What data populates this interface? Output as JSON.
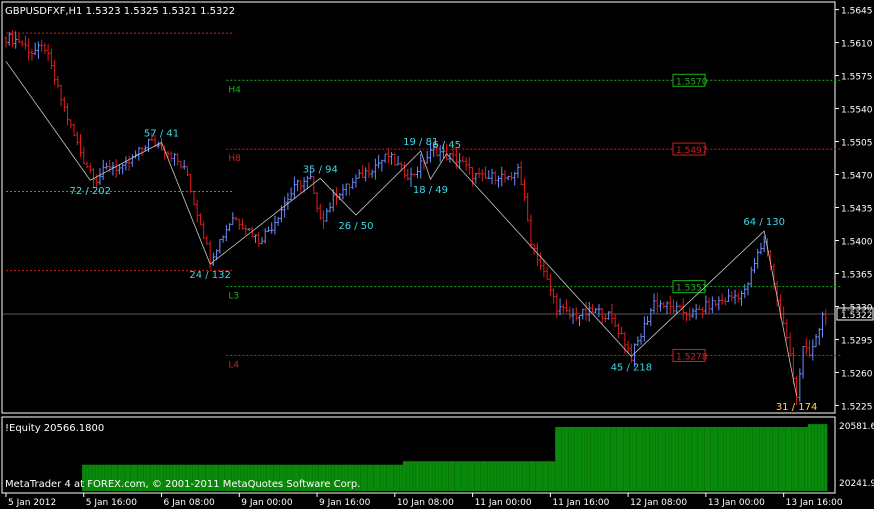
{
  "header": {
    "title": "GBPUSDFXF,H1  1.5323 1.5325 1.5321 1.5322"
  },
  "footer": {
    "copyright": "MetaTrader 4 at FOREX.com, © 2001-2011 MetaQuotes Software Corp."
  },
  "colors": {
    "background": "#000000",
    "border": "#ffffff",
    "bull_bar": "#6b8dff",
    "bear_bar": "#e21b1b",
    "zigzag": "#c8c8c8",
    "zigzag_label": "#3fd7e8",
    "zigzag_label_low_end": "#ffd84a",
    "level_green": "#1db31d",
    "level_red": "#d11f1f",
    "equity_bar": "#0a8a0a",
    "text": "#ffffff"
  },
  "chart_data": [
    {
      "type": "ohlc",
      "symbol": "GBPUSDFXF",
      "timeframe": "H1",
      "last_quote": {
        "open": 1.5323,
        "high": 1.5325,
        "low": 1.5321,
        "close": 1.5322
      },
      "ylim": [
        1.5218,
        1.5652
      ],
      "y_ticks": [
        "1.5645",
        "1.5610",
        "1.5575",
        "1.5540",
        "1.5505",
        "1.5470",
        "1.5435",
        "1.5400",
        "1.5365",
        "1.5330",
        "1.5295",
        "1.5260",
        "1.5225"
      ],
      "current_price_label": "1.5322",
      "x_ticks": [
        "5 Jan 2012",
        "5 Jan 16:00",
        "6 Jan 08:00",
        "9 Jan 00:00",
        "9 Jan 16:00",
        "10 Jan 08:00",
        "11 Jan 00:00",
        "11 Jan 16:00",
        "12 Jan 08:00",
        "13 Jan 00:00",
        "13 Jan 16:00"
      ],
      "price_path": [
        [
          0,
          1.5615
        ],
        [
          4,
          1.5612
        ],
        [
          8,
          1.56
        ],
        [
          12,
          1.5605
        ],
        [
          16,
          1.556
        ],
        [
          20,
          1.552
        ],
        [
          24,
          1.5485
        ],
        [
          28,
          1.5465
        ],
        [
          32,
          1.548
        ],
        [
          36,
          1.5475
        ],
        [
          40,
          1.549
        ],
        [
          44,
          1.5505
        ],
        [
          48,
          1.55
        ],
        [
          52,
          1.5488
        ],
        [
          56,
          1.547
        ],
        [
          58,
          1.544
        ],
        [
          60,
          1.542
        ],
        [
          63,
          1.538
        ],
        [
          66,
          1.54
        ],
        [
          70,
          1.5425
        ],
        [
          74,
          1.5415
        ],
        [
          78,
          1.54
        ],
        [
          82,
          1.5415
        ],
        [
          86,
          1.544
        ],
        [
          90,
          1.546
        ],
        [
          94,
          1.5465
        ],
        [
          96,
          1.543
        ],
        [
          98,
          1.5425
        ],
        [
          102,
          1.545
        ],
        [
          106,
          1.5458
        ],
        [
          110,
          1.547
        ],
        [
          114,
          1.548
        ],
        [
          118,
          1.549
        ],
        [
          122,
          1.5475
        ],
        [
          125,
          1.5468
        ],
        [
          128,
          1.548
        ],
        [
          132,
          1.5497
        ],
        [
          136,
          1.549
        ],
        [
          140,
          1.5485
        ],
        [
          144,
          1.547
        ],
        [
          148,
          1.5465
        ],
        [
          152,
          1.547
        ],
        [
          156,
          1.5462
        ],
        [
          158,
          1.548
        ],
        [
          160,
          1.5442
        ],
        [
          162,
          1.54
        ],
        [
          166,
          1.5365
        ],
        [
          170,
          1.533
        ],
        [
          174,
          1.532
        ],
        [
          178,
          1.5322
        ],
        [
          182,
          1.5325
        ],
        [
          186,
          1.532
        ],
        [
          190,
          1.53
        ],
        [
          193,
          1.5277
        ],
        [
          196,
          1.53
        ],
        [
          200,
          1.5335
        ],
        [
          204,
          1.533
        ],
        [
          208,
          1.5325
        ],
        [
          212,
          1.5322
        ],
        [
          216,
          1.533
        ],
        [
          220,
          1.5335
        ],
        [
          224,
          1.534
        ],
        [
          228,
          1.5345
        ],
        [
          232,
          1.5385
        ],
        [
          234,
          1.54
        ],
        [
          236,
          1.5375
        ],
        [
          238,
          1.5335
        ],
        [
          240,
          1.531
        ],
        [
          242,
          1.528
        ],
        [
          244,
          1.5235
        ],
        [
          246,
          1.5285
        ],
        [
          248,
          1.5278
        ],
        [
          250,
          1.5295
        ],
        [
          252,
          1.532
        ],
        [
          253,
          1.5322
        ]
      ],
      "zigzag": {
        "points": [
          [
            0,
            1.559
          ],
          [
            26,
            1.5464
          ],
          [
            48,
            1.5504
          ],
          [
            63,
            1.5375
          ],
          [
            97,
            1.5466
          ],
          [
            108,
            1.5427
          ],
          [
            128,
            1.5495
          ],
          [
            131,
            1.5465
          ],
          [
            136,
            1.5492
          ],
          [
            193,
            1.5277
          ],
          [
            234,
            1.541
          ],
          [
            244,
            1.5235
          ]
        ],
        "labels": [
          {
            "text": "72 / 202",
            "i": 26,
            "price": 1.5464,
            "pos": "below"
          },
          {
            "text": "57 / 41",
            "i": 48,
            "price": 1.5504,
            "pos": "above"
          },
          {
            "text": "24 / 132",
            "i": 63,
            "price": 1.5375,
            "pos": "below"
          },
          {
            "text": "35 / 94",
            "i": 97,
            "price": 1.5466,
            "pos": "above"
          },
          {
            "text": "26 / 50",
            "i": 108,
            "price": 1.5427,
            "pos": "below"
          },
          {
            "text": "19 / 81",
            "i": 128,
            "price": 1.5495,
            "pos": "above"
          },
          {
            "text": "18 / 49",
            "i": 131,
            "price": 1.5465,
            "pos": "below"
          },
          {
            "text": "6 / 45",
            "i": 136,
            "price": 1.5492,
            "pos": "above"
          },
          {
            "text": "45 / 218",
            "i": 193,
            "price": 1.5277,
            "pos": "below"
          },
          {
            "text": "64 / 130",
            "i": 234,
            "price": 1.541,
            "pos": "above"
          },
          {
            "text": "31 / 174",
            "i": 244,
            "price": 1.5235,
            "pos": "below",
            "color": "zigzag_label_low_end"
          }
        ]
      },
      "levels": [
        {
          "label": "",
          "price": 1.562,
          "color": "level_red",
          "from": 0,
          "to": 68
        },
        {
          "label": "H4",
          "price": 1.557,
          "color": "level_green",
          "from": 68,
          "to": 256,
          "tag": "1.5570"
        },
        {
          "label": "H8",
          "price": 1.5497,
          "color": "level_red",
          "from": 68,
          "to": 256,
          "tag": "1.5497"
        },
        {
          "label": "",
          "price": 1.5452,
          "color": "level_green",
          "from": 0,
          "to": 68
        },
        {
          "label": "",
          "price": 1.5368,
          "color": "level_red",
          "from": 0,
          "to": 68
        },
        {
          "label": "L3",
          "price": 1.5351,
          "color": "level_green",
          "from": 68,
          "to": 256,
          "tag": "1.5351"
        },
        {
          "label": "L4",
          "price": 1.5278,
          "color": "level_red",
          "from": 68,
          "to": 256,
          "tag": "1.5278"
        }
      ]
    },
    {
      "type": "bar",
      "name": "!Equity 20566.1800",
      "ylim": [
        20241.9,
        20581.6
      ],
      "y_ticks": [
        "20581.6",
        "20241.9"
      ],
      "segments": [
        {
          "from": 0,
          "to": 24,
          "value": null
        },
        {
          "from": 24,
          "to": 123,
          "value": 20372
        },
        {
          "from": 123,
          "to": 170,
          "value": 20390
        },
        {
          "from": 170,
          "to": 248,
          "value": 20566
        },
        {
          "from": 248,
          "to": 254,
          "value": 20581
        }
      ]
    }
  ]
}
